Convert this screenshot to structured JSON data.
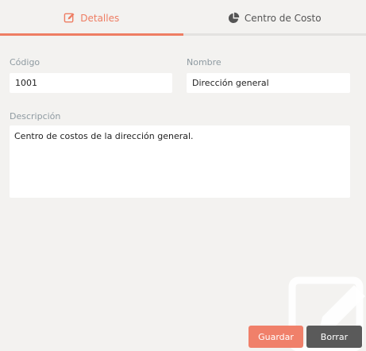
{
  "tabs": [
    {
      "label": "Detalles",
      "icon": "edit-icon",
      "active": true
    },
    {
      "label": "Centro de Costo",
      "icon": "pie-chart-icon",
      "active": false
    }
  ],
  "form": {
    "code": {
      "label": "Código",
      "value": "1001"
    },
    "name": {
      "label": "Nombre",
      "value": "Dirección general"
    },
    "description": {
      "label": "Descripción",
      "value": "Centro de costos de la dirección general."
    }
  },
  "actions": {
    "save_label": "Guardar",
    "delete_label": "Borrar"
  },
  "colors": {
    "accent": "#ee7d63",
    "save_button": "#f0806a",
    "delete_button": "#5a5a5a",
    "background": "#f3f2f0"
  }
}
